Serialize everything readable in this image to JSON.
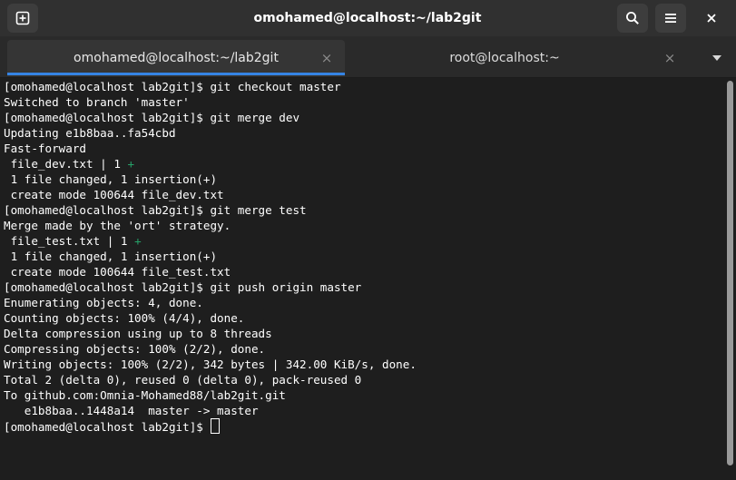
{
  "window": {
    "title": "omohamed@localhost:~/lab2git"
  },
  "header": {
    "new_tab_icon": "new-tab-icon",
    "search_icon": "search-icon",
    "menu_icon": "hamburger-menu-icon",
    "close_icon": "close-icon"
  },
  "tabs": [
    {
      "label": "omohamed@localhost:~/lab2git",
      "close": "×",
      "active": true
    },
    {
      "label": "root@localhost:~",
      "close": "×",
      "active": false
    }
  ],
  "colors": {
    "accent": "#3584e4",
    "diff_plus": "#26a269",
    "terminal_bg": "#1e1e1e",
    "terminal_fg": "#ffffff"
  },
  "terminal": {
    "lines": [
      "[omohamed@localhost lab2git]$ git checkout master",
      "Switched to branch 'master'",
      "[omohamed@localhost lab2git]$ git merge dev",
      "Updating e1b8baa..fa54cbd",
      "Fast-forward",
      " file_dev.txt | 1 ",
      " 1 file changed, 1 insertion(+)",
      " create mode 100644 file_dev.txt",
      "[omohamed@localhost lab2git]$ git merge test",
      "Merge made by the 'ort' strategy.",
      " file_test.txt | 1 ",
      " 1 file changed, 1 insertion(+)",
      " create mode 100644 file_test.txt",
      "[omohamed@localhost lab2git]$ git push origin master",
      "Enumerating objects: 4, done.",
      "Counting objects: 100% (4/4), done.",
      "Delta compression using up to 8 threads",
      "Compressing objects: 100% (2/2), done.",
      "Writing objects: 100% (2/2), 342 bytes | 342.00 KiB/s, done.",
      "Total 2 (delta 0), reused 0 (delta 0), pack-reused 0",
      "To github.com:Omnia-Mohamed88/lab2git.git",
      "   e1b8baa..1448a14  master -> master"
    ],
    "diff_plus": "+",
    "prompt": "[omohamed@localhost lab2git]$ "
  }
}
